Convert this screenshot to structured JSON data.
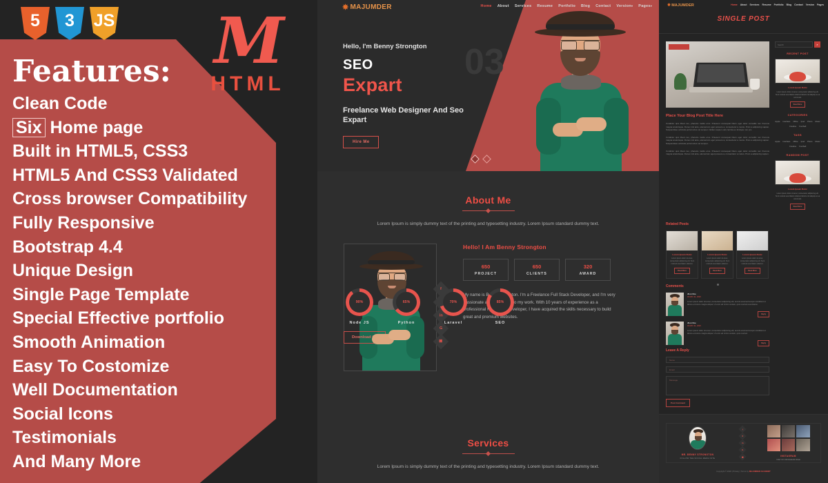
{
  "left": {
    "badges": [
      {
        "name": "html5-badge",
        "label": "5"
      },
      {
        "name": "css3-badge",
        "label": "3"
      },
      {
        "name": "js-badge",
        "label": "JS"
      }
    ],
    "logo_glyph": "M",
    "logo_sub": "HTML",
    "title": "Features:",
    "items": [
      {
        "text": "Clean Code"
      },
      {
        "boxed": "Six",
        "text": " Home page"
      },
      {
        "text": "Built in HTML5, CSS3"
      },
      {
        "text": "HTML5 And CSS3 Validated"
      },
      {
        "text": "Cross browser Compatibility"
      },
      {
        "text": "Fully Responsive"
      },
      {
        "text": "Bootstrap 4.4"
      },
      {
        "text": "Unique Design"
      },
      {
        "text": "Single Page Template"
      },
      {
        "text": "Special Effective portfolio"
      },
      {
        "text": "Smooth Animation"
      },
      {
        "text": "Easy To Costomize"
      },
      {
        "text": "Well Documentation"
      },
      {
        "text": "Social Icons"
      },
      {
        "text": "Testimonials"
      },
      {
        "text": "And Many More"
      }
    ]
  },
  "center": {
    "logo": "MAJUMDER",
    "nav": [
      {
        "label": "Home",
        "active": true
      },
      {
        "label": "About",
        "active": false
      },
      {
        "label": "Services",
        "active": false
      },
      {
        "label": "Resume",
        "active": false
      },
      {
        "label": "Portfolio",
        "active": false
      },
      {
        "label": "Blog",
        "active": false
      },
      {
        "label": "Contact",
        "active": false
      },
      {
        "label": "Version",
        "caret": true,
        "active": false
      },
      {
        "label": "Pages",
        "caret": true,
        "active": false
      }
    ],
    "hero": {
      "greeting": "Hello, I'm Benny Strongton",
      "title_line1": "SEO",
      "title_line2": "Expart",
      "subtitle": "Freelance Web Designer And Seo Expart",
      "button": "Hire Me",
      "slide_number": "03"
    },
    "about": {
      "title": "About Me",
      "desc": "Lorem Ipsum is simply dummy text of the printing and typesetting industry. Lorem Ipsum standard dummy text.",
      "heading": "Hello! I Am Benny Strongton",
      "stats": [
        {
          "number": "650",
          "label": "PROJECT"
        },
        {
          "number": "650",
          "label": "CLIENTS"
        },
        {
          "number": "320",
          "label": "AWARD"
        }
      ],
      "paragraph": "My name is Benny Strongton. I'm a Freelance Full Stack Developer, and I'm very passionate and dedicated to my work. With 10 years of experience as a professional Full Stack Developer, I have acquired the skills necessary to build great and premium websites.",
      "social": [
        {
          "name": "facebook-icon",
          "glyph": "f"
        },
        {
          "name": "twitter-icon",
          "glyph": "✶"
        },
        {
          "name": "linkedin-icon",
          "glyph": "in"
        },
        {
          "name": "google-plus-icon",
          "glyph": "G"
        },
        {
          "name": "instagram-icon",
          "glyph": "▣"
        }
      ],
      "skills": [
        {
          "name": "Node JS",
          "percent": "90%",
          "value": 90
        },
        {
          "name": "Python",
          "percent": "65%",
          "value": 65
        },
        {
          "name": "Laravel",
          "percent": "70%",
          "value": 70
        },
        {
          "name": "SEO",
          "percent": "85%",
          "value": 85
        }
      ],
      "download_button": "Download CV"
    },
    "services": {
      "title": "Services",
      "desc": "Lorem Ipsum is simply dummy text of the printing and typesetting industry. Lorem Ipsum standard dummy text."
    }
  },
  "right": {
    "logo": "MAJUMDER",
    "nav": [
      {
        "label": "Home",
        "active": true
      },
      {
        "label": "About",
        "active": false
      },
      {
        "label": "Services",
        "active": false
      },
      {
        "label": "Resume",
        "active": false
      },
      {
        "label": "Portfolio",
        "active": false
      },
      {
        "label": "Blog",
        "active": false
      },
      {
        "label": "Contact",
        "active": false
      },
      {
        "label": "Version",
        "active": false
      },
      {
        "label": "Pages",
        "active": false
      }
    ],
    "page_title": "SINGLE POST",
    "post": {
      "title": "Place Your Blog Post Title Here",
      "paragraphs": [
        "Curabitur quis libero leo, pharetra mattis eros. Praesent consequat libero eget dolor convallis nec rhoncus magna scelerisque. Donec nisl ante, elementum eget posuere a, consectetur a metus. Proin a adipiscing sapien. Suspendisse vehicula porta luctus vel semper. Nullam sapien velit, lacinia eu tristique non pro.",
        "Curabitur quis libero leo, pharetra mattis eros. Praesent consequat libero eget dolor convallis nec rhoncus magna scelerisque. Donec nisl ante, elementum eget posuere a, consectetur a metus. Proin a adipiscing sapien. Suspendisse vehicula porta luctus vel semper.",
        "Curabitur quis libero leo, pharetra mattis eros. Praesent consequat libero eget dolor convallis nec rhoncus magna scelerisque. Donec nisl ante, elementum eget posuere a, consectetur a metus. Proin a adipiscing sapien."
      ]
    },
    "related": {
      "heading": "Related Posts",
      "cards": [
        {
          "title": "Lorem Ipsum Dolor",
          "text": "Lorem ipsum dolor sit amet, consectetur adipiscing elit. Sunt nostrud exercitation ullamco.",
          "button": "Read More"
        },
        {
          "title": "Lorem Ipsum Dolor",
          "text": "Lorem ipsum dolor sit amet, consectetur adipiscing elit. Sunt nostrud exercitation ullamco.",
          "button": "Read More"
        },
        {
          "title": "Lorem Ipsum Dolor",
          "text": "Lorem ipsum dolor sit amet, consectetur adipiscing elit. Sunt nostrud exercitation ullamco.",
          "button": "Read More"
        }
      ]
    },
    "comments": {
      "heading": "Comments",
      "items": [
        {
          "name": "Jhon Doe",
          "date": "03 MAY 21, 2020",
          "text": "Lorem ipsum dolor sit amet, consectetur adipiscing elit, sed do eiusmod tempor incididunt ut labore et dolore magna aliqua. Ut enim ad minim veniam, quis nostrud exercitation.",
          "reply": "Reply"
        },
        {
          "name": "Jhon Doe",
          "date": "03 MAY 21, 2020",
          "text": "Lorem ipsum dolor sit amet, consectetur adipiscing elit, sed do eiusmod tempor incididunt ut labore et dolore magna aliqua. Ut enim ad minim veniam, quis nostrud.",
          "reply": "Reply"
        }
      ]
    },
    "reply_form": {
      "heading": "Leave A Reply",
      "name_placeholder": "Name",
      "email_placeholder": "Email",
      "message_placeholder": "Message",
      "submit": "Post Comment"
    },
    "sidebar": {
      "search_placeholder": "Search",
      "search_icon": "⌕",
      "recent_post": {
        "title": "RECENT POST",
        "post_title": "Lorem Ipsum Dolor",
        "post_text": "Lorem ipsum dolor sit amet, consectetur adipiscing elit. Sunt nostrud exercitation ullamco laboris nisi aliquip ex ea commodo.",
        "button": "Read More"
      },
      "categories": {
        "title": "CATEGORIES",
        "tags": [
          "Apple",
          "Interface",
          "Office",
          "Ipod",
          "Photo",
          "Music",
          "Creative",
          "Football"
        ]
      },
      "tags": {
        "title": "TAGS",
        "tags": [
          "Apple",
          "Interface",
          "Office",
          "Ipod",
          "Photo",
          "Music",
          "Creative",
          "Football"
        ]
      },
      "random_post": {
        "title": "RANDOM POST",
        "post_title": "Lorem Ipsum Dolor",
        "post_text": "Lorem ipsum dolor sit amet, consectetur adipiscing elit. Sunt nostrud exercitation ullamco laboris nisi aliquip ex ea commodo.",
        "button": "Read More"
      }
    },
    "footer": {
      "profile_name": "MR. BENNY STRONGTON",
      "profile_tagline": "FOLLOW THE SOCIAL MEDIA SITE",
      "social": [
        {
          "name": "facebook-icon",
          "glyph": "f"
        },
        {
          "name": "twitter-icon",
          "glyph": "✶"
        },
        {
          "name": "linkedin-icon",
          "glyph": "in"
        },
        {
          "name": "google-plus-icon",
          "glyph": "G"
        },
        {
          "name": "instagram-icon",
          "glyph": "▣"
        }
      ],
      "instagram_title": "INSTAGRAM",
      "instagram_sub": "VISIT MY INSTAGRAM PAGE",
      "copyright_pre": "Copyright © 2020 | Privacy | Terms by ",
      "copyright_brand": "MAJUMDER ACADEMY"
    }
  },
  "colors": {
    "accent_red": "#e8504a",
    "panel_red": "#b54c48",
    "dark_bg": "#2b2b2b",
    "panel_dark": "#232323"
  }
}
